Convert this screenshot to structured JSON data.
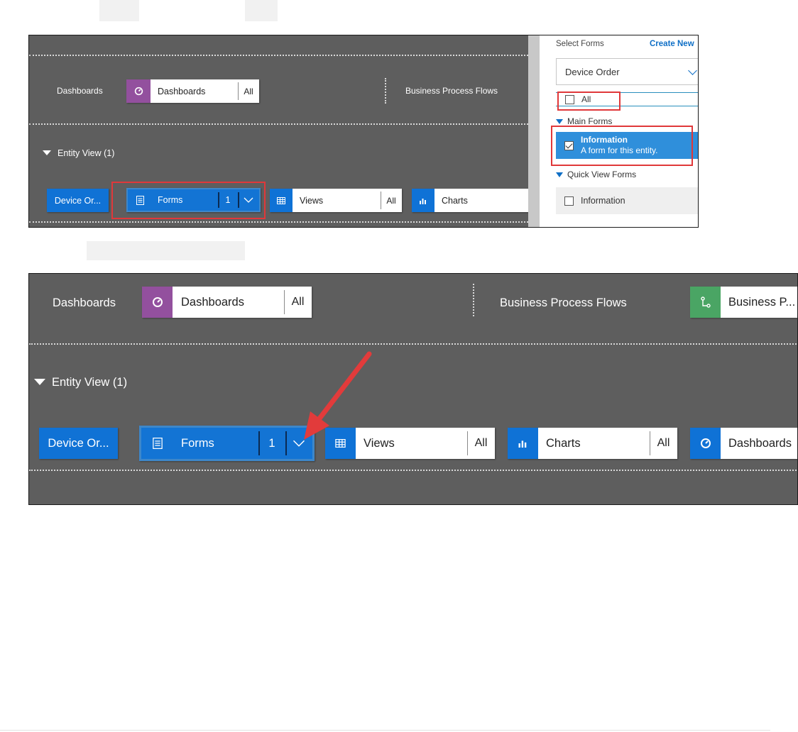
{
  "top_panel": {
    "dashboards_row_label": "Dashboards",
    "dashboards_tile": {
      "label": "Dashboards",
      "count": "All",
      "color": "#93509e"
    },
    "bpf_row_label": "Business Process Flows",
    "entity_view_label": "Entity View (1)",
    "entity_button": "Device Or...",
    "forms_tile": {
      "label": "Forms",
      "count": "1"
    },
    "views_tile": {
      "label": "Views",
      "count": "All"
    },
    "charts_tile": {
      "label": "Charts",
      "count": ""
    },
    "side_panel": {
      "header": "Select Forms",
      "create_link": "Create New",
      "select_value": "Device Order",
      "all_label": "All",
      "main_forms_label": "Main Forms",
      "main_form_item": {
        "title": "Information",
        "subtitle": "A form for this entity.",
        "checked": true
      },
      "quick_view_label": "Quick View Forms",
      "quick_view_item": {
        "title": "Information",
        "checked": false
      }
    }
  },
  "bottom_panel": {
    "dashboards_row_label": "Dashboards",
    "dashboards_tile": {
      "label": "Dashboards",
      "count": "All"
    },
    "bpf_row_label": "Business Process Flows",
    "bpf_tile": {
      "label": "Business P...",
      "color": "#4aa564"
    },
    "entity_view_label": "Entity View (1)",
    "entity_button": "Device Or...",
    "forms_tile": {
      "label": "Forms",
      "count": "1"
    },
    "views_tile": {
      "label": "Views",
      "count": "All"
    },
    "charts_tile": {
      "label": "Charts",
      "count": "All"
    },
    "dashboards2_tile": {
      "label": "Dashboards"
    }
  },
  "colors": {
    "panel_bg": "#5e5e5e",
    "accent_blue": "#1374d4",
    "highlight_red": "#e0383a",
    "arrow_red": "#e23b3b"
  }
}
